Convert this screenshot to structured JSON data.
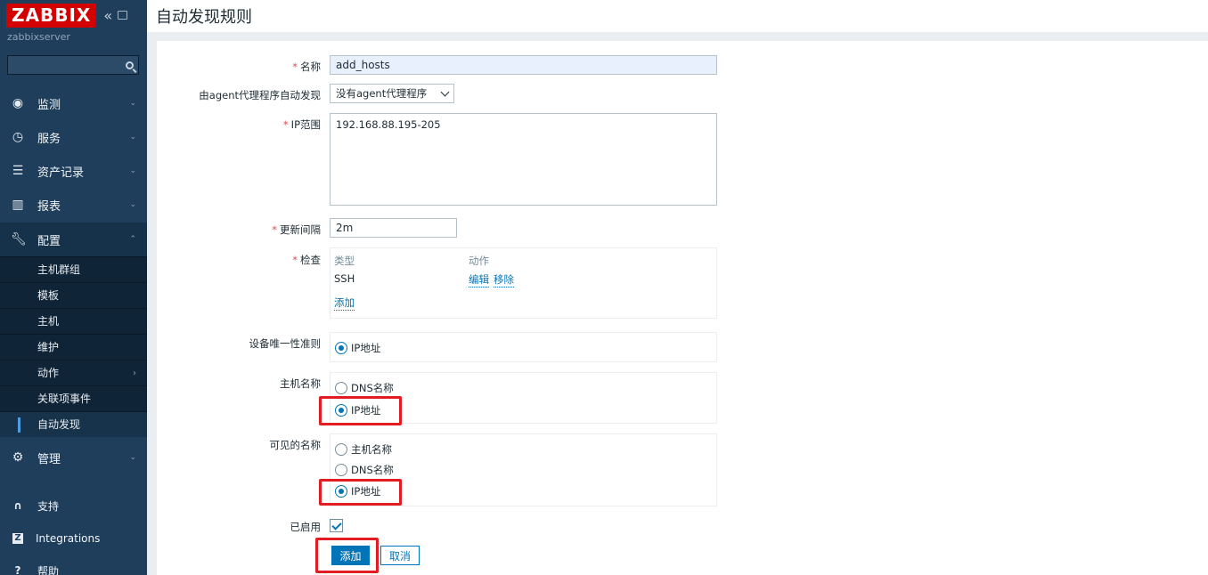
{
  "app": {
    "logo": "ZABBIX",
    "server_name": "zabbixserver",
    "page_title": "自动发现规则"
  },
  "sidebar": {
    "nav": [
      {
        "label": "监测",
        "icon": "eye-icon"
      },
      {
        "label": "服务",
        "icon": "clock-icon"
      },
      {
        "label": "资产记录",
        "icon": "list-icon"
      },
      {
        "label": "报表",
        "icon": "bar-chart-icon"
      },
      {
        "label": "配置",
        "icon": "wrench-icon"
      }
    ],
    "submenu": [
      {
        "label": "主机群组"
      },
      {
        "label": "模板"
      },
      {
        "label": "主机"
      },
      {
        "label": "维护"
      },
      {
        "label": "动作"
      },
      {
        "label": "关联项事件"
      },
      {
        "label": "自动发现"
      }
    ],
    "admin": {
      "label": "管理",
      "icon": "gear-icon"
    },
    "footer": [
      {
        "label": "支持",
        "icon": "headset-icon"
      },
      {
        "label": "Integrations",
        "icon": "zabbix-z-icon"
      },
      {
        "label": "帮助",
        "icon": "help-icon"
      }
    ]
  },
  "form": {
    "name": {
      "label": "名称",
      "value": "add_hosts"
    },
    "proxy": {
      "label": "由agent代理程序自动发现",
      "value": "没有agent代理程序"
    },
    "ip_range": {
      "label": "IP范围",
      "value": "192.168.88.195-205"
    },
    "delay": {
      "label": "更新间隔",
      "value": "2m"
    },
    "checks": {
      "label": "检查",
      "col_type": "类型",
      "col_action": "动作",
      "rows": [
        {
          "type": "SSH",
          "edit": "编辑",
          "remove": "移除"
        }
      ],
      "add": "添加"
    },
    "uniqueness": {
      "label": "设备唯一性准则",
      "options": [
        "IP地址"
      ]
    },
    "host_name": {
      "label": "主机名称",
      "options": [
        "DNS名称",
        "IP地址"
      ]
    },
    "visible_name": {
      "label": "可见的名称",
      "options": [
        "主机名称",
        "DNS名称",
        "IP地址"
      ]
    },
    "enabled": {
      "label": "已启用",
      "checked": true
    },
    "buttons": {
      "add": "添加",
      "cancel": "取消"
    }
  },
  "colors": {
    "accent": "#0275b8",
    "sidebar": "#1f3e5b",
    "highlight": "#e31b23"
  }
}
